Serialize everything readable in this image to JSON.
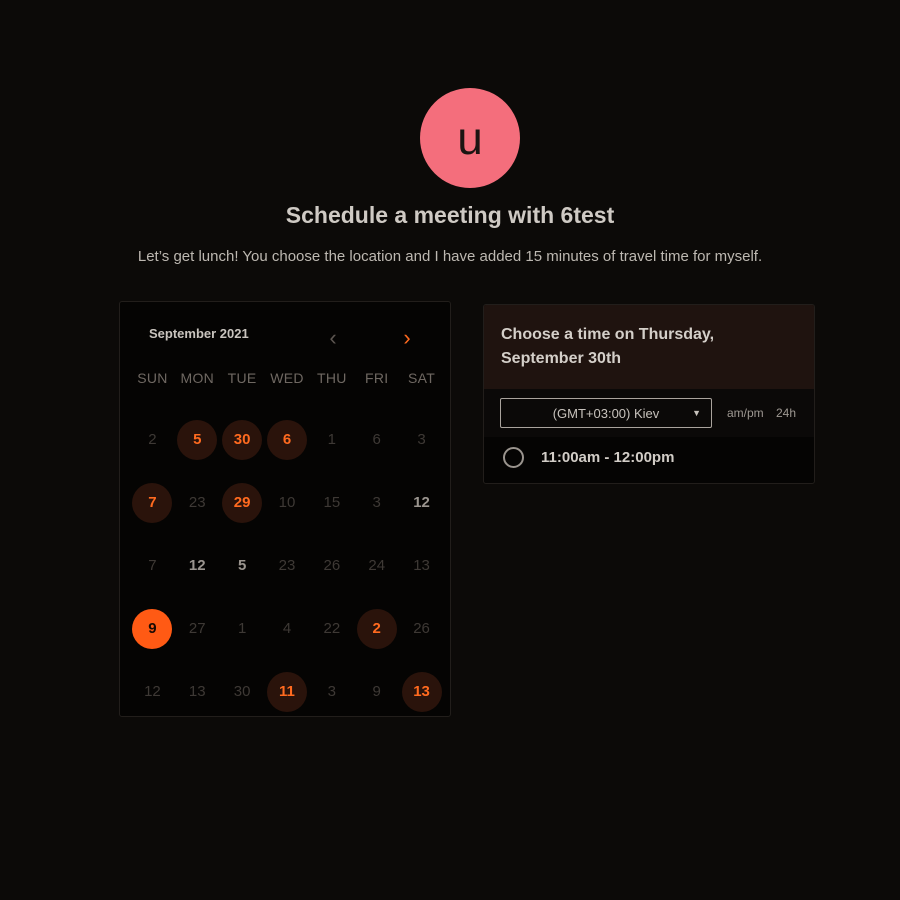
{
  "header": {
    "avatar_letter": "u",
    "title": "Schedule a meeting with 6test",
    "description": "Let’s get lunch! You choose the location and I have added 15 minutes of travel time for myself."
  },
  "calendar": {
    "month_label": "September 2021",
    "prev_icon": "chevron-left-icon",
    "next_icon": "chevron-right-icon",
    "weekdays": [
      "SUN",
      "MON",
      "TUE",
      "WED",
      "THU",
      "FRI",
      "SAT"
    ],
    "days": [
      {
        "label": "2",
        "state": "faded"
      },
      {
        "label": "5",
        "state": "available"
      },
      {
        "label": "30",
        "state": "available"
      },
      {
        "label": "6",
        "state": "available"
      },
      {
        "label": "1",
        "state": "faded"
      },
      {
        "label": "6",
        "state": "faded"
      },
      {
        "label": "3",
        "state": "faded"
      },
      {
        "label": "7",
        "state": "available"
      },
      {
        "label": "23",
        "state": "faded"
      },
      {
        "label": "29",
        "state": "available"
      },
      {
        "label": "10",
        "state": "faded"
      },
      {
        "label": "15",
        "state": "faded"
      },
      {
        "label": "3",
        "state": "faded"
      },
      {
        "label": "12",
        "state": "normal"
      },
      {
        "label": "7",
        "state": "faded"
      },
      {
        "label": "12",
        "state": "normal"
      },
      {
        "label": "5",
        "state": "normal"
      },
      {
        "label": "23",
        "state": "faded"
      },
      {
        "label": "26",
        "state": "faded"
      },
      {
        "label": "24",
        "state": "faded"
      },
      {
        "label": "13",
        "state": "faded"
      },
      {
        "label": "9",
        "state": "selected"
      },
      {
        "label": "27",
        "state": "faded"
      },
      {
        "label": "1",
        "state": "faded"
      },
      {
        "label": "4",
        "state": "faded"
      },
      {
        "label": "22",
        "state": "faded"
      },
      {
        "label": "2",
        "state": "available"
      },
      {
        "label": "26",
        "state": "faded"
      },
      {
        "label": "12",
        "state": "faded"
      },
      {
        "label": "13",
        "state": "faded"
      },
      {
        "label": "30",
        "state": "faded"
      },
      {
        "label": "11",
        "state": "available"
      },
      {
        "label": "3",
        "state": "faded"
      },
      {
        "label": "9",
        "state": "faded"
      },
      {
        "label": "13",
        "state": "available"
      }
    ]
  },
  "time_panel": {
    "heading": "Choose a time on Thursday, September 30th",
    "timezone": "(GMT+03:00) Kiev",
    "format_12h": "am/pm",
    "format_24h": "24h",
    "slots": [
      "11:00am - 12:00pm"
    ]
  },
  "colors": {
    "background": "#0c0a08",
    "accent": "#ff6a1f",
    "avatar": "#f46e7c"
  }
}
